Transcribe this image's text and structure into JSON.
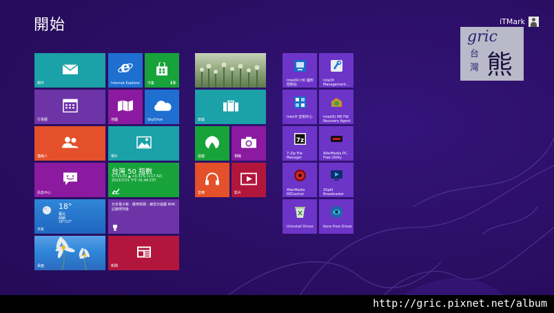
{
  "screen": {
    "title": "開始",
    "user_name": "iTMark"
  },
  "tiles": {
    "mail": {
      "label": "郵件",
      "color": "#1ba1a8",
      "icon": "mail-icon"
    },
    "ie": {
      "label": "Internet Explorer",
      "color": "#1f6fd1",
      "icon": "internet-explorer-icon"
    },
    "store": {
      "label": "市集",
      "badge": "15",
      "color": "#17a33a",
      "icon": "store-icon"
    },
    "photo_top": {
      "label": "",
      "color": "#7c9a6a",
      "icon": "photo-thumbnail"
    },
    "calendar": {
      "label": "行事曆",
      "color": "#6d34a8",
      "icon": "calendar-icon"
    },
    "maps": {
      "label": "地圖",
      "color": "#8b1aa0",
      "icon": "maps-icon"
    },
    "skydrive": {
      "label": "SkyDrive",
      "color": "#1f6fd1",
      "icon": "skydrive-icon"
    },
    "travel": {
      "label": "旅遊",
      "color": "#1ba1a8",
      "icon": "travel-icon"
    },
    "people": {
      "label": "連絡人",
      "color": "#e4502a",
      "icon": "people-icon"
    },
    "photos": {
      "label": "相片",
      "color": "#1ba1a8",
      "icon": "photos-icon"
    },
    "games": {
      "label": "遊戲",
      "color": "#17a33a",
      "icon": "games-icon"
    },
    "camera": {
      "label": "相機",
      "color": "#8b1aa0",
      "icon": "camera-icon"
    },
    "messaging": {
      "label": "訊息中心",
      "color": "#8b1aa0",
      "icon": "messaging-icon"
    },
    "finance": {
      "title": "台灣 50 指數",
      "line1": "5,715.03 ▲ +0.31% (+17.42)",
      "line2": "2013/7/15 下午 01:44 CST",
      "color": "#17a33a",
      "icon": "finance-icon"
    },
    "music": {
      "label": "音樂",
      "color": "#e4502a",
      "icon": "music-icon"
    },
    "video": {
      "label": "影片",
      "color": "#b3163c",
      "icon": "video-icon"
    },
    "weather": {
      "temp": "18°",
      "city": "臺北",
      "cond": "晴朗",
      "range": "18°/12°",
      "label": "天氣",
      "color": "#2777d6",
      "icon": "weather-icon"
    },
    "sports": {
      "text": "日本電子競 - 體育新聞 - 練習日遊戲 NHK記錄男則後",
      "color": "#6d34a8",
      "icon": "trophy-icon"
    },
    "desktop": {
      "label": "桌面",
      "color": "#2f86d8",
      "icon": "desktop-thumbnail"
    },
    "news": {
      "label": "新聞",
      "color": "#b3163c",
      "icon": "news-icon"
    }
  },
  "apps": [
    {
      "label": "Intel(R) HD 圖形控制台",
      "icon": "intel-graphics-icon"
    },
    {
      "label": "Intel® Management...",
      "icon": "intel-management-icon"
    },
    {
      "label": "Intel® 控制中心",
      "icon": "intel-control-center-icon"
    },
    {
      "label": "Intel(R) ME FW Recovery Agent",
      "icon": "intel-me-fw-icon"
    },
    {
      "label": "7-Zip File Manager",
      "icon": "7zip-icon"
    },
    {
      "label": "AVerMedia PC-Free Utility",
      "icon": "avermedia-pcfree-icon"
    },
    {
      "label": "AVerMedia RECentral",
      "icon": "avermedia-recentral-icon"
    },
    {
      "label": "XSplit Broadcaster",
      "icon": "xsplit-icon"
    },
    {
      "label": "Uninstall Driver",
      "icon": "uninstall-driver-icon"
    },
    {
      "label": "Kone Pure Driver",
      "icon": "kone-pure-driver-icon"
    }
  ],
  "apps_color": "#6d34c8",
  "watermark": {
    "line1": "gric",
    "line2": "台",
    "line3": "灣",
    "line4": "熊"
  },
  "url_bar": {
    "text": "http://gric.pixnet.net/album"
  }
}
